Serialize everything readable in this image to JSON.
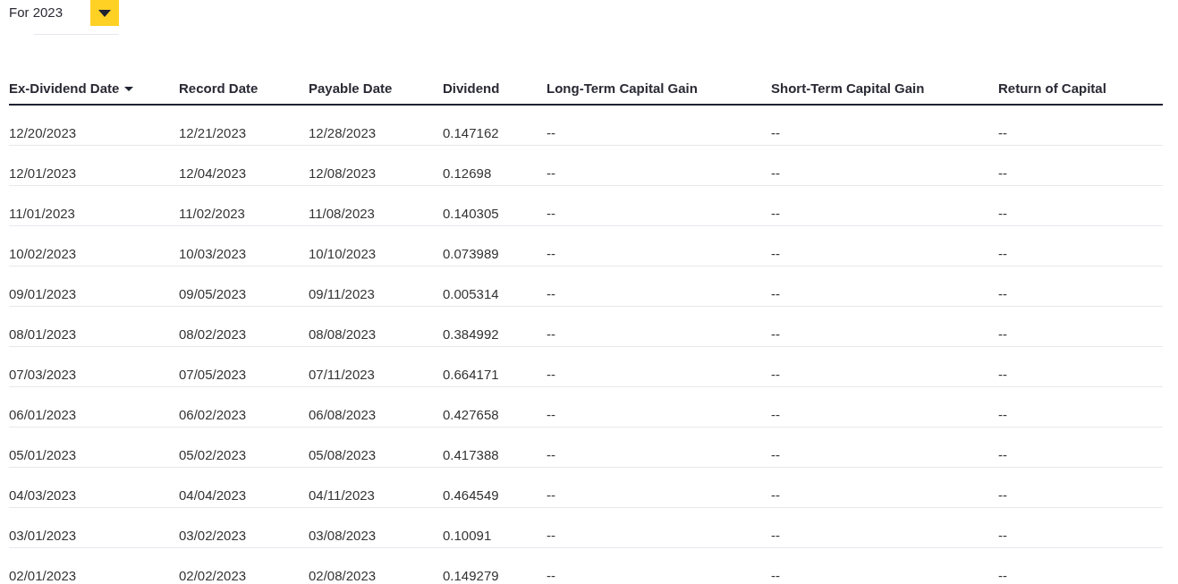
{
  "year_filter": {
    "label": "For 2023"
  },
  "table": {
    "columns": [
      {
        "label": "Ex-Dividend Date",
        "sorted": true
      },
      {
        "label": "Record Date",
        "sorted": false
      },
      {
        "label": "Payable Date",
        "sorted": false
      },
      {
        "label": "Dividend",
        "sorted": false
      },
      {
        "label": "Long-Term Capital Gain",
        "sorted": false
      },
      {
        "label": "Short-Term Capital Gain",
        "sorted": false
      },
      {
        "label": "Return of Capital",
        "sorted": false
      }
    ],
    "rows": [
      [
        "12/20/2023",
        "12/21/2023",
        "12/28/2023",
        "0.147162",
        "--",
        "--",
        "--"
      ],
      [
        "12/01/2023",
        "12/04/2023",
        "12/08/2023",
        "0.12698",
        "--",
        "--",
        "--"
      ],
      [
        "11/01/2023",
        "11/02/2023",
        "11/08/2023",
        "0.140305",
        "--",
        "--",
        "--"
      ],
      [
        "10/02/2023",
        "10/03/2023",
        "10/10/2023",
        "0.073989",
        "--",
        "--",
        "--"
      ],
      [
        "09/01/2023",
        "09/05/2023",
        "09/11/2023",
        "0.005314",
        "--",
        "--",
        "--"
      ],
      [
        "08/01/2023",
        "08/02/2023",
        "08/08/2023",
        "0.384992",
        "--",
        "--",
        "--"
      ],
      [
        "07/03/2023",
        "07/05/2023",
        "07/11/2023",
        "0.664171",
        "--",
        "--",
        "--"
      ],
      [
        "06/01/2023",
        "06/02/2023",
        "06/08/2023",
        "0.427658",
        "--",
        "--",
        "--"
      ],
      [
        "05/01/2023",
        "05/02/2023",
        "05/08/2023",
        "0.417388",
        "--",
        "--",
        "--"
      ],
      [
        "04/03/2023",
        "04/04/2023",
        "04/11/2023",
        "0.464549",
        "--",
        "--",
        "--"
      ],
      [
        "03/01/2023",
        "03/02/2023",
        "03/08/2023",
        "0.10091",
        "--",
        "--",
        "--"
      ],
      [
        "02/01/2023",
        "02/02/2023",
        "02/08/2023",
        "0.149279",
        "--",
        "--",
        "--"
      ]
    ]
  }
}
